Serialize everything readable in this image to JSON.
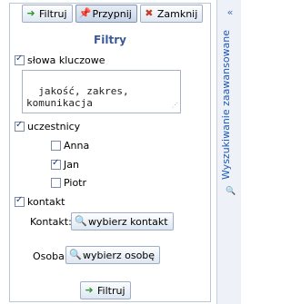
{
  "toolbar": {
    "filter_label": "Filtruj",
    "pin_label": "Przypnij",
    "close_label": "Zamknij"
  },
  "panel": {
    "title": "Filtry",
    "keywords": {
      "label": "słowa kluczowe",
      "checked": true,
      "value": "jakość, zakres,\nkomunikacja"
    },
    "participants": {
      "label": "uczestnicy",
      "checked": true,
      "items": [
        {
          "label": "Anna",
          "checked": false
        },
        {
          "label": "Jan",
          "checked": true
        },
        {
          "label": "Piotr",
          "checked": false
        }
      ]
    },
    "contact": {
      "label": "kontakt",
      "checked": true,
      "contact_label": "Kontakt:",
      "contact_button": "wybierz kontakt",
      "person_label": "Osoba:",
      "person_button": "wybierz osobę"
    },
    "bottom_filter_label": "Filtruj"
  },
  "sidebar": {
    "advanced_search_label": "Wyszukiwanie zaawansowane"
  },
  "icons": {
    "filter": "green-arrow-right",
    "pin": "pushpin",
    "close": "red-x",
    "search": "magnifier",
    "collapse": "double-chevron-left"
  }
}
